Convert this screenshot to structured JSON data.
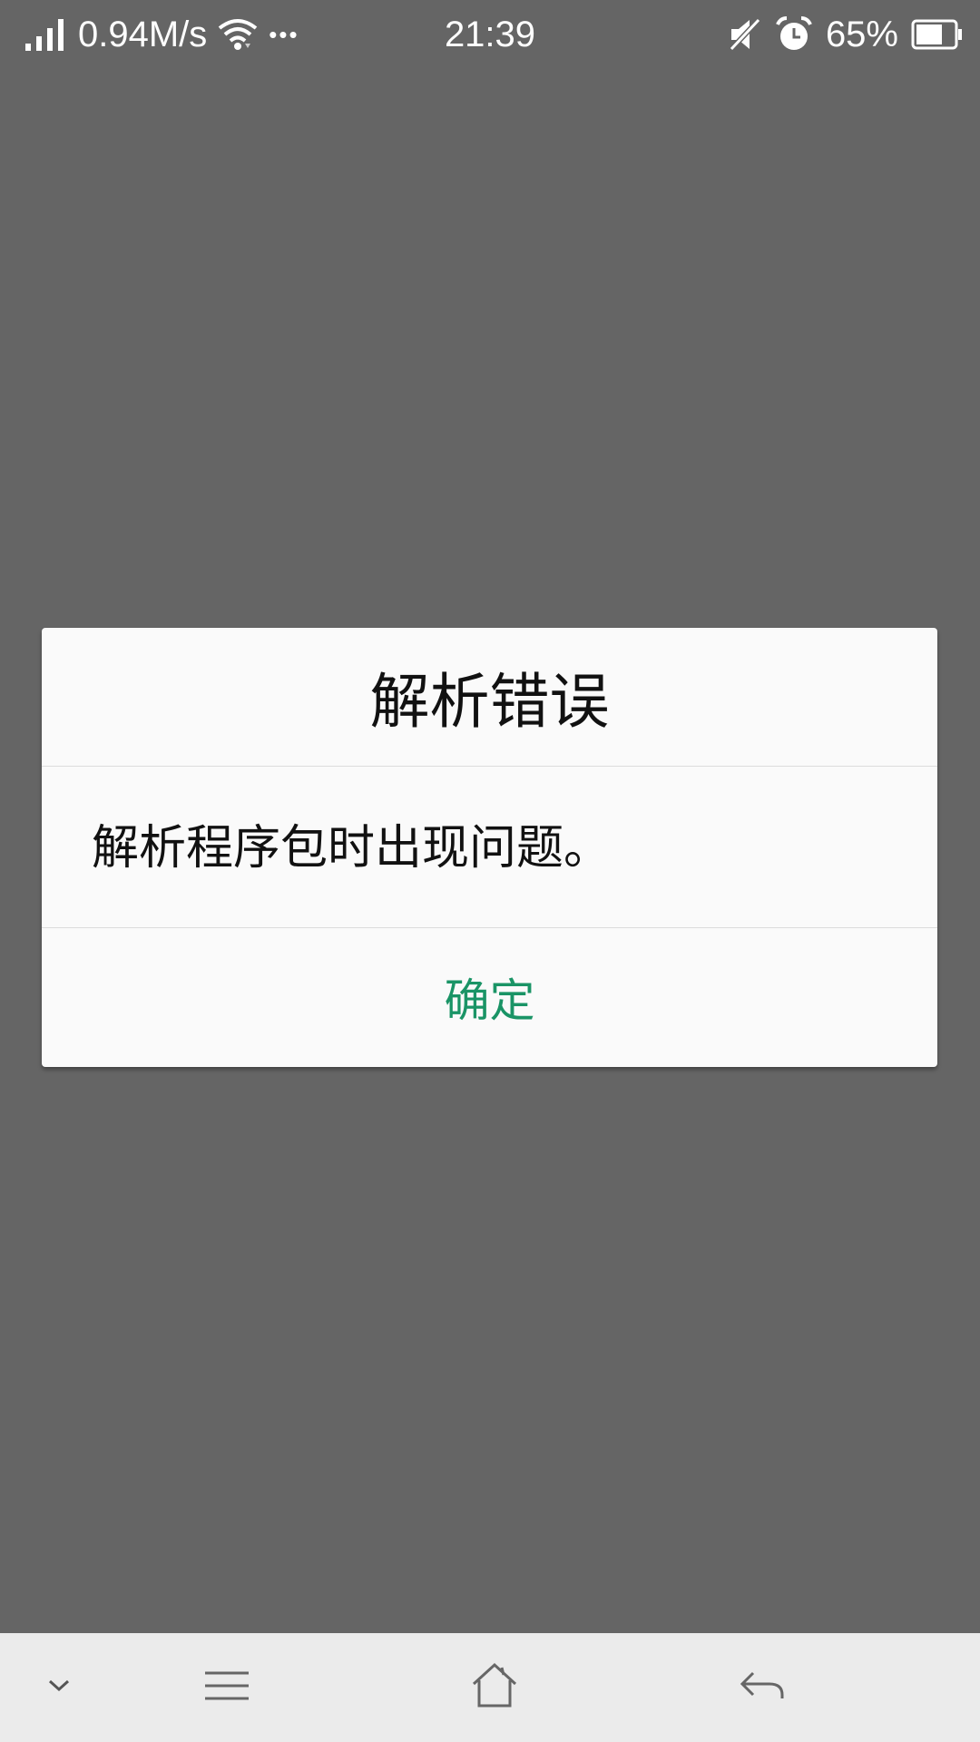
{
  "status_bar": {
    "speed": "0.94M/s",
    "more": "•••",
    "time": "21:39",
    "battery": "65%",
    "icons": [
      "signal-icon",
      "wifi-icon",
      "mute-icon",
      "alarm-icon",
      "battery-icon"
    ]
  },
  "dialog": {
    "title": "解析错误",
    "message": "解析程序包时出现问题。",
    "ok_label": "确定",
    "accent_color": "#1a9466"
  },
  "nav_bar": {
    "icons": [
      "chevron-down-icon",
      "menu-icon",
      "home-icon",
      "back-icon"
    ]
  }
}
